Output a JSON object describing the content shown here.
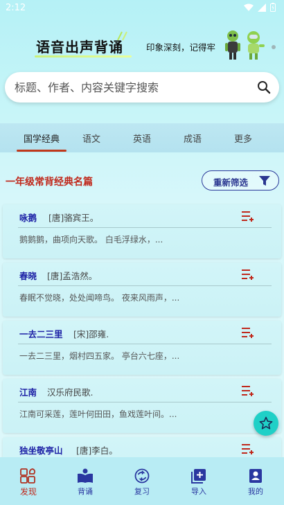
{
  "status": {
    "time": "2:12"
  },
  "header": {
    "title": "语音出声背诵",
    "slogan": "印象深刻，记得牢"
  },
  "search": {
    "placeholder": "标题、作者、内容关键字搜索"
  },
  "tabs": [
    {
      "label": "国学经典"
    },
    {
      "label": "语文"
    },
    {
      "label": "英语"
    },
    {
      "label": "成语"
    },
    {
      "label": "更多"
    }
  ],
  "section": {
    "title": "一年级常背经典名篇",
    "filter_label": "重新筛选"
  },
  "poems": [
    {
      "title": "咏鹅",
      "author": "[唐]骆宾王。",
      "excerpt": "鹅鹅鹅，曲项向天歌。 白毛浮绿水，..."
    },
    {
      "title": "春晓",
      "author": "[唐]孟浩然。",
      "excerpt": "春眠不觉晓，处处闻啼鸟。 夜来风雨声，..."
    },
    {
      "title": "一去二三里",
      "author": "[宋]邵雍.",
      "excerpt": "一去二三里，烟村四五家。 亭台六七座，..."
    },
    {
      "title": "江南",
      "author": "汉乐府民歌.",
      "excerpt": "江南可采莲，莲叶何田田，鱼戏莲叶间。..."
    },
    {
      "title": "独坐敬亭山",
      "author": "[唐]李白。",
      "excerpt": ""
    }
  ],
  "bottom_nav": [
    {
      "label": "发现",
      "icon": "discover-icon"
    },
    {
      "label": "背诵",
      "icon": "book-icon"
    },
    {
      "label": "复习",
      "icon": "review-icon"
    },
    {
      "label": "导入",
      "icon": "import-icon"
    },
    {
      "label": "我的",
      "icon": "profile-icon"
    }
  ],
  "colors": {
    "accent": "#c0281b",
    "title_blue": "#1e22a6",
    "nav_blue": "#2a37a0",
    "fab": "#1fd0c7"
  }
}
